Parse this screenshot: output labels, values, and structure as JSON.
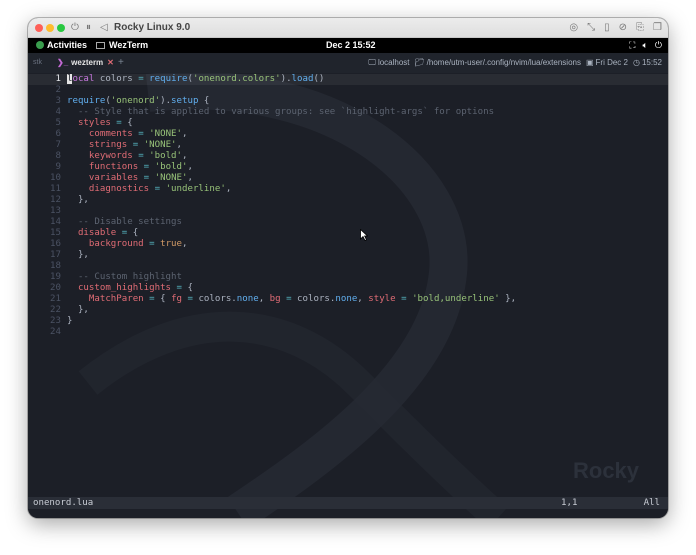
{
  "window": {
    "title": "Rocky Linux 9.0",
    "controls": [
      "power-icon",
      "pause-icon",
      "back-icon"
    ],
    "right_tools": [
      "disk-icon",
      "resize-icon",
      "usb-icon",
      "compass-icon",
      "share-icon",
      "window-icon"
    ]
  },
  "topbar": {
    "activities": "Activities",
    "app": "WezTerm",
    "clock": "Dec 2  15:52",
    "right_icons": [
      "network-icon",
      "volume-icon",
      "power-icon"
    ]
  },
  "tabbar": {
    "prev_label": "stk",
    "active_tab": "wezterm",
    "close_glyph": "✕",
    "add_glyph": "+",
    "host": "localhost",
    "path": "/home/utm-user/.config/nvim/lua/extensions",
    "date": "Fri Dec 2",
    "time": "15:52"
  },
  "editor": {
    "lines": [
      {
        "n": "1",
        "tokens": [
          [
            "cursor",
            "l"
          ],
          [
            "kw",
            "ocal"
          ],
          [
            "pr",
            " colors "
          ],
          [
            "op",
            "="
          ],
          [
            "pr",
            " "
          ],
          [
            "fn",
            "require"
          ],
          [
            "pr",
            "("
          ],
          [
            "str",
            "'onenord.colors'"
          ],
          [
            "pr",
            ")."
          ],
          [
            "fn",
            "load"
          ],
          [
            "pr",
            "()"
          ]
        ]
      },
      {
        "n": "2",
        "tokens": []
      },
      {
        "n": "3",
        "tokens": [
          [
            "fn",
            "require"
          ],
          [
            "pr",
            "("
          ],
          [
            "str",
            "'onenord'"
          ],
          [
            "pr",
            ")."
          ],
          [
            "fn",
            "setup"
          ],
          [
            "pr",
            " {"
          ]
        ]
      },
      {
        "n": "4",
        "tokens": [
          [
            "cm",
            "  -- Style that is applied to various groups: see `highlight-args` for options"
          ]
        ]
      },
      {
        "n": "5",
        "tokens": [
          [
            "var",
            "  styles"
          ],
          [
            "pr",
            " "
          ],
          [
            "op",
            "="
          ],
          [
            "pr",
            " {"
          ]
        ]
      },
      {
        "n": "6",
        "tokens": [
          [
            "var",
            "    comments"
          ],
          [
            "pr",
            " "
          ],
          [
            "op",
            "="
          ],
          [
            "pr",
            " "
          ],
          [
            "str",
            "'NONE'"
          ],
          [
            "pr",
            ","
          ]
        ]
      },
      {
        "n": "7",
        "tokens": [
          [
            "var",
            "    strings"
          ],
          [
            "pr",
            " "
          ],
          [
            "op",
            "="
          ],
          [
            "pr",
            " "
          ],
          [
            "str",
            "'NONE'"
          ],
          [
            "pr",
            ","
          ]
        ]
      },
      {
        "n": "8",
        "tokens": [
          [
            "var",
            "    keywords"
          ],
          [
            "pr",
            " "
          ],
          [
            "op",
            "="
          ],
          [
            "pr",
            " "
          ],
          [
            "str",
            "'bold'"
          ],
          [
            "pr",
            ","
          ]
        ]
      },
      {
        "n": "9",
        "tokens": [
          [
            "var",
            "    functions"
          ],
          [
            "pr",
            " "
          ],
          [
            "op",
            "="
          ],
          [
            "pr",
            " "
          ],
          [
            "str",
            "'bold'"
          ],
          [
            "pr",
            ","
          ]
        ]
      },
      {
        "n": "10",
        "tokens": [
          [
            "var",
            "    variables"
          ],
          [
            "pr",
            " "
          ],
          [
            "op",
            "="
          ],
          [
            "pr",
            " "
          ],
          [
            "str",
            "'NONE'"
          ],
          [
            "pr",
            ","
          ]
        ]
      },
      {
        "n": "11",
        "tokens": [
          [
            "var",
            "    diagnostics"
          ],
          [
            "pr",
            " "
          ],
          [
            "op",
            "="
          ],
          [
            "pr",
            " "
          ],
          [
            "str",
            "'underline'"
          ],
          [
            "pr",
            ","
          ]
        ]
      },
      {
        "n": "12",
        "tokens": [
          [
            "pr",
            "  },"
          ]
        ]
      },
      {
        "n": "13",
        "tokens": []
      },
      {
        "n": "14",
        "tokens": [
          [
            "cm",
            "  -- Disable settings"
          ]
        ]
      },
      {
        "n": "15",
        "tokens": [
          [
            "var",
            "  disable"
          ],
          [
            "pr",
            " "
          ],
          [
            "op",
            "="
          ],
          [
            "pr",
            " {"
          ]
        ]
      },
      {
        "n": "16",
        "tokens": [
          [
            "var",
            "    background"
          ],
          [
            "pr",
            " "
          ],
          [
            "op",
            "="
          ],
          [
            "pr",
            " "
          ],
          [
            "num-v",
            "true"
          ],
          [
            "pr",
            ","
          ]
        ]
      },
      {
        "n": "17",
        "tokens": [
          [
            "pr",
            "  },"
          ]
        ]
      },
      {
        "n": "18",
        "tokens": []
      },
      {
        "n": "19",
        "tokens": [
          [
            "cm",
            "  -- Custom highlight"
          ]
        ]
      },
      {
        "n": "20",
        "tokens": [
          [
            "var",
            "  custom_highlights"
          ],
          [
            "pr",
            " "
          ],
          [
            "op",
            "="
          ],
          [
            "pr",
            " {"
          ]
        ]
      },
      {
        "n": "21",
        "tokens": [
          [
            "var",
            "    MatchParen"
          ],
          [
            "pr",
            " "
          ],
          [
            "op",
            "="
          ],
          [
            "pr",
            " { "
          ],
          [
            "var",
            "fg"
          ],
          [
            "pr",
            " "
          ],
          [
            "op",
            "="
          ],
          [
            "pr",
            " colors."
          ],
          [
            "fn",
            "none"
          ],
          [
            "pr",
            ", "
          ],
          [
            "var",
            "bg"
          ],
          [
            "pr",
            " "
          ],
          [
            "op",
            "="
          ],
          [
            "pr",
            " colors."
          ],
          [
            "fn",
            "none"
          ],
          [
            "pr",
            ", "
          ],
          [
            "var",
            "style"
          ],
          [
            "pr",
            " "
          ],
          [
            "op",
            "="
          ],
          [
            "pr",
            " "
          ],
          [
            "str",
            "'bold,underline'"
          ],
          [
            "pr",
            " },"
          ]
        ]
      },
      {
        "n": "22",
        "tokens": [
          [
            "pr",
            "  },"
          ]
        ]
      },
      {
        "n": "23",
        "tokens": [
          [
            "pr",
            "}"
          ]
        ]
      },
      {
        "n": "24",
        "tokens": []
      }
    ]
  },
  "statusline": {
    "filename": "onenord.lua",
    "position": "1,1",
    "scroll": "All"
  },
  "watermark": "Rocky"
}
